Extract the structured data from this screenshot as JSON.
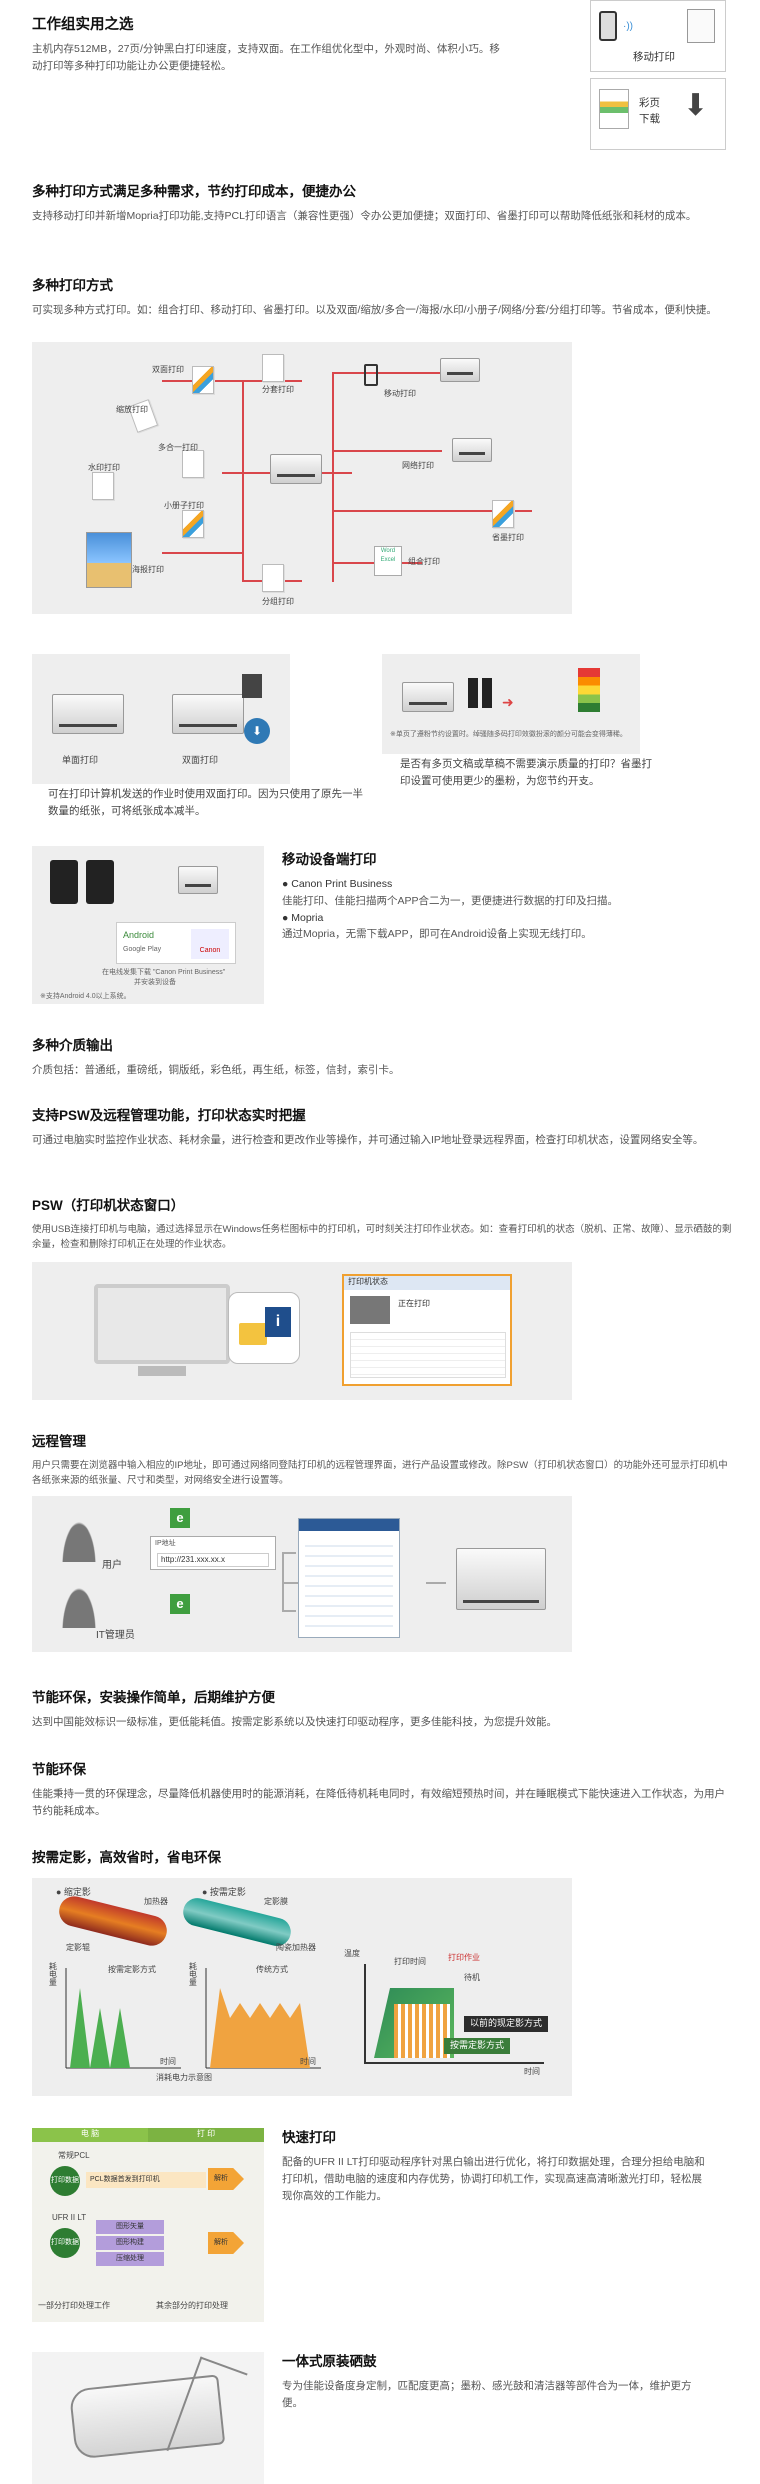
{
  "intro": {
    "title": "工作组实用之选",
    "body": "主机内存512MB，27页/分钟黑白打印速度，支持双面。在工作组优化型中，外观时尚、体积小巧。移动打印等多种打印功能让办公更便捷轻松。"
  },
  "side_cards": {
    "mobile_label": "移动打印",
    "color_label_1": "彩页",
    "color_label_2": "下载"
  },
  "multi_print": {
    "title": "多种打印方式满足多种需求，节约打印成本，便捷办公",
    "body": "支持移动打印并新增Mopria打印功能,支持PCL打印语言（兼容性更强）令办公更加便捷；双面打印、省墨打印可以帮助降低纸张和耗材的成本。"
  },
  "methods": {
    "title": "多种打印方式",
    "body": "可实现多种方式打印。如：组合打印、移动打印、省墨打印。以及双面/缩放/多合一/海报/水印/小册子/网络/分套/分组打印等。节省成本，便利快捷。",
    "diagram": {
      "duplex": "双面打印",
      "scale": "缩放打印",
      "nup": "多合一打印",
      "watermark": "水印打印",
      "booklet": "小册子打印",
      "poster": "海报打印",
      "collate": "分套打印",
      "mobile": "移动打印",
      "network": "网络打印",
      "eco": "省墨打印",
      "combo": "组合打印",
      "group": "分组打印"
    }
  },
  "duplex_panel": {
    "single": "单面打印",
    "double": "双面打印",
    "caption": "可在打印计算机发送的作业时使用双面打印。因为只使用了原先一半数量的纸张，可将纸张成本减半。"
  },
  "eco_panel": {
    "note": "※单页了遵粉节约设置时。绰骚随多码打印效徽扮滚的颜分可能会变得薄稀。",
    "caption": "是否有多页文稿或草稿不需要演示质量的打印？省墨打印设置可使用更少的墨粉，为您节约开支。"
  },
  "mobile": {
    "title": "移动设备端打印",
    "item1_title": "● Canon Print Business",
    "item1_body": "佳能打印、佳能扫描两个APP合二为一，更便捷进行数据的打印及扫描。",
    "item2_title": "● Mopria",
    "item2_body": "通过Mopria，无需下载APP，即可在Android设备上实现无线打印。",
    "img_android": "Android",
    "img_store": "Google Play",
    "img_canon": "Canon",
    "img_caption1": "在电线发集下载 \"Canon Print Business\"",
    "img_caption2": "并安装到设备",
    "img_note": "※支持Android 4.0以上系统。"
  },
  "media": {
    "title": "多种介质输出",
    "body": "介质包括：普通纸，重磅纸，铜版纸，彩色纸，再生纸，标签，信封，索引卡。"
  },
  "psw_mgmt": {
    "title": "支持PSW及远程管理功能，打印状态实时把握",
    "body": "可通过电脑实时监控作业状态、耗材余量，进行检查和更改作业等操作，并可通过输入IP地址登录远程界面，检查打印机状态，设置网络安全等。"
  },
  "psw": {
    "title": "PSW（打印机状态窗口）",
    "body": "使用USB连接打印机与电脑，通过选择显示在Windows任务栏图标中的打印机，可时刻关注打印作业状态。如：查看打印机的状态（脱机、正常、故障）、显示硒鼓的剩余量，检查和删除打印机正在处理的作业状态。",
    "window_title": "打印机状态",
    "window_status": "正在打印"
  },
  "remote": {
    "title": "远程管理",
    "body": "用户只需要在浏览器中输入相应的IP地址，即可通过网络同登陆打印机的远程管理界面，进行产品设置或修改。除PSW（打印机状态窗口）的功能外还可显示打印机中各纸张来源的纸张量、尺寸和类型，对网络安全进行设置等。",
    "user": "用户",
    "admin": "IT管理员",
    "ip_label": "IP地址",
    "ip_value": "http://231.xxx.xx.x"
  },
  "eco_friendly": {
    "title": "节能环保，安装操作简单，后期维护方便",
    "body": "达到中国能效标识一级标准，更低能耗值。按需定影系统以及快速打印驱动程序，更多佳能科技，为您提升效能。"
  },
  "env": {
    "title": "节能环保",
    "body": "佳能秉持一贯的环保理念，尽量降低机器使用时的能源消耗，在降低待机耗电同时，有效缩短预热时间，并在睡眠模式下能快速进入工作状态，为用户节约能耗成本。"
  },
  "ondemand": {
    "title": "按需定影，高效省时，省电环保",
    "left_heading": "● 缩定影",
    "right_heading": "● 按需定影",
    "heater": "加热器",
    "roller": "定影辊",
    "film": "定影膜",
    "ceramic": "陶瓷加热器",
    "power": "耗电量",
    "time": "时间",
    "ondemand_way": "按需定影方式",
    "traditional_way": "传统方式",
    "consumption": "消耗电力示意图",
    "temp": "温度",
    "print_time": "打印时间",
    "print_job": "打印作业",
    "standby": "待机",
    "old_way": "以前的现定影方式",
    "new_way": "按需定影方式",
    "time2": "时间"
  },
  "fast_print": {
    "title": "快速打印",
    "body": "配备的UFR II LT打印驱动程序针对黑白输出进行优化，将打印数据处理，合理分担给电脑和打印机，借助电脑的速度和内存优势，协调打印机工作，实现高速高清晰激光打印，轻松展现你高效的工作能力。",
    "col_pc": "电 脑",
    "col_printer": "打 印",
    "pcl": "常规PCL",
    "print_data_pcl": "打印数据",
    "pcl_desc": "PCL数据首发到打印机",
    "parse1": "解析",
    "ufr": "UFR II LT",
    "print_data_ufr": "打印数据",
    "ufr_s1": "图形矢量",
    "ufr_s2": "图形构建",
    "ufr_s3": "压缩处理",
    "parse2": "解析",
    "bottom_left": "一部分打印处理工作",
    "bottom_right": "其余部分的打印处理"
  },
  "cartridge": {
    "title": "一体式原装硒鼓",
    "body": "专为佳能设备度身定制，匹配度更高；墨粉、感光鼓和清洁器等部件合为一体，维护更方便。"
  }
}
